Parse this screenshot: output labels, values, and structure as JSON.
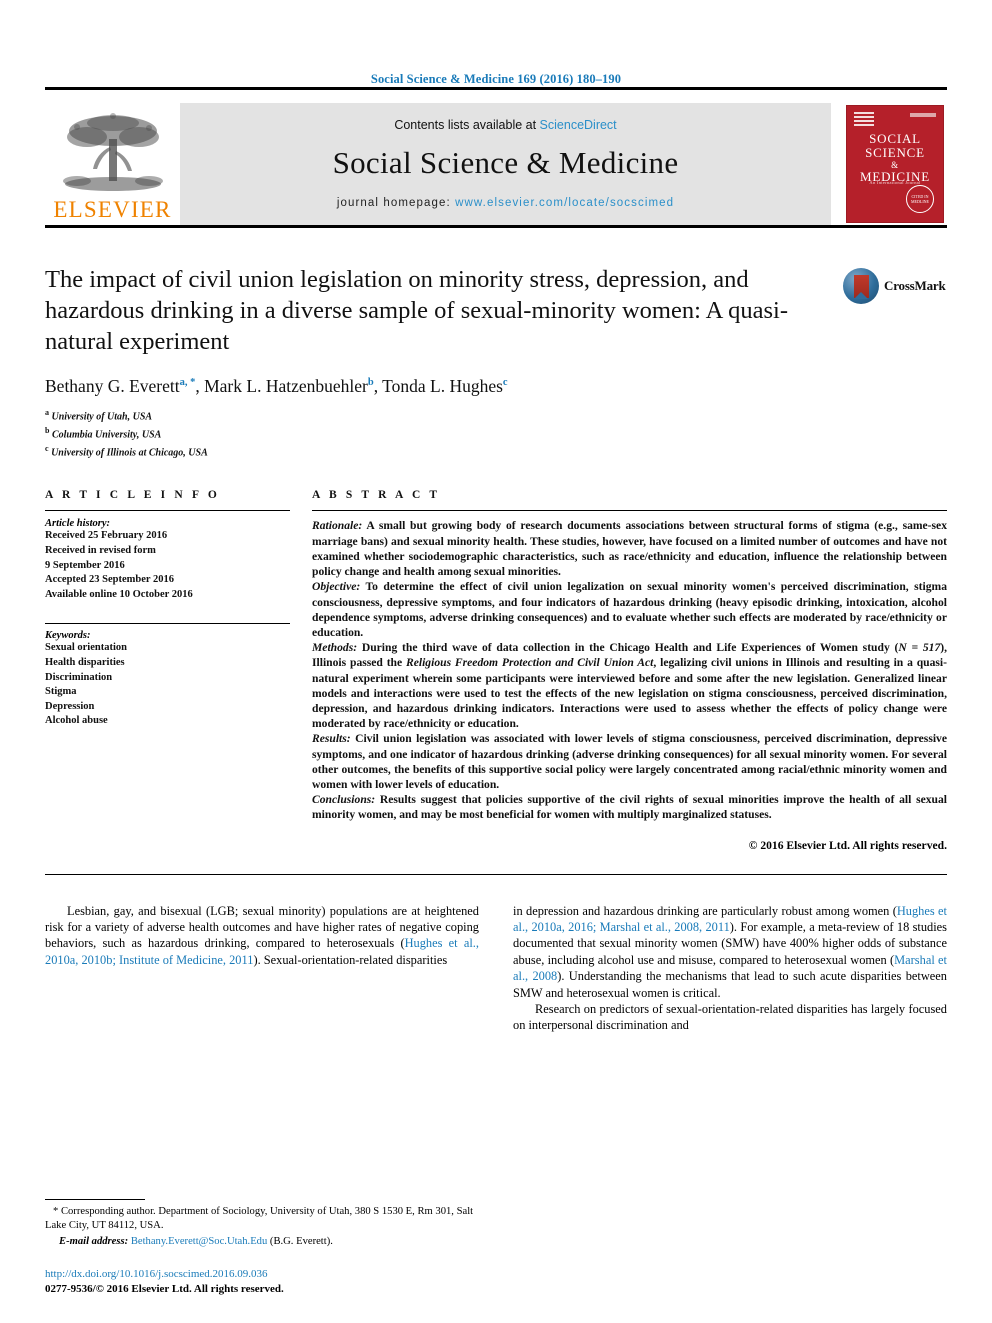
{
  "running_head": "Social Science & Medicine 169 (2016) 180–190",
  "masthead": {
    "publisher_wordmark": "ELSEVIER",
    "contents_prefix": "Contents lists available at ",
    "contents_link": "ScienceDirect",
    "journal_name": "Social Science & Medicine",
    "homepage_prefix": "journal homepage: ",
    "homepage_url": "www.elsevier.com/locate/socscimed",
    "cover": {
      "line1": "SOCIAL",
      "line2": "SCIENCE",
      "amp": "&",
      "line3": "MEDICINE",
      "tagline": "An International Journal",
      "seal_text": "CITED IN MEDLINE"
    }
  },
  "crossmark": {
    "label": "CrossMark"
  },
  "title": "The impact of civil union legislation on minority stress, depression, and hazardous drinking in a diverse sample of sexual-minority women: A quasi-natural experiment",
  "authors": [
    {
      "name": "Bethany G. Everett",
      "marks": "a, *"
    },
    {
      "name": "Mark L. Hatzenbuehler",
      "marks": "b"
    },
    {
      "name": "Tonda L. Hughes",
      "marks": "c"
    }
  ],
  "affiliations": [
    {
      "mark": "a",
      "text": "University of Utah, USA"
    },
    {
      "mark": "b",
      "text": "Columbia University, USA"
    },
    {
      "mark": "c",
      "text": "University of Illinois at Chicago, USA"
    }
  ],
  "article_info": {
    "heading": "A R T I C L E  I N F O",
    "history_label": "Article history:",
    "history": [
      "Received 25 February 2016",
      "Received in revised form",
      "9 September 2016",
      "Accepted 23 September 2016",
      "Available online 10 October 2016"
    ],
    "keywords_label": "Keywords:",
    "keywords": [
      "Sexual orientation",
      "Health disparities",
      "Discrimination",
      "Stigma",
      "Depression",
      "Alcohol abuse"
    ]
  },
  "abstract": {
    "heading": "A B S T R A C T",
    "rationale_label": "Rationale:",
    "rationale_text": " A small but growing body of research documents associations between structural forms of stigma (e.g., same-sex marriage bans) and sexual minority health. These studies, however, have focused on a limited number of outcomes and have not examined whether sociodemographic characteristics, such as race/ethnicity and education, influence the relationship between policy change and health among sexual minorities.",
    "objective_label": "Objective:",
    "objective_text": " To determine the effect of civil union legalization on sexual minority women's perceived discrimination, stigma consciousness, depressive symptoms, and four indicators of hazardous drinking (heavy episodic drinking, intoxication, alcohol dependence symptoms, adverse drinking consequences) and to evaluate whether such effects are moderated by race/ethnicity or education.",
    "methods_label": "Methods:",
    "methods_text_1": " During the third wave of data collection in the Chicago Health and Life Experiences of Women study (",
    "methods_n": "N = 517",
    "methods_text_2": "), Illinois passed the ",
    "methods_act": "Religious Freedom Protection and Civil Union Act",
    "methods_text_3": ", legalizing civil unions in Illinois and resulting in a quasi-natural experiment wherein some participants were interviewed before and some after the new legislation. Generalized linear models and interactions were used to test the effects of the new legislation on stigma consciousness, perceived discrimination, depression, and hazardous drinking indicators. Interactions were used to assess whether the effects of policy change were moderated by race/ethnicity or education.",
    "results_label": "Results:",
    "results_text": " Civil union legislation was associated with lower levels of stigma consciousness, perceived discrimination, depressive symptoms, and one indicator of hazardous drinking (adverse drinking consequences) for all sexual minority women. For several other outcomes, the benefits of this supportive social policy were largely concentrated among racial/ethnic minority women and women with lower levels of education.",
    "conclusions_label": "Conclusions:",
    "conclusions_text": " Results suggest that policies supportive of the civil rights of sexual minorities improve the health of all sexual minority women, and may be most beneficial for women with multiply marginalized statuses.",
    "copyright": "© 2016 Elsevier Ltd. All rights reserved."
  },
  "body": {
    "left_col": {
      "seg1": "Lesbian, gay, and bisexual (LGB; sexual minority) populations are at heightened risk for a variety of adverse health outcomes and have higher rates of negative coping behaviors, such as hazardous drinking, compared to heterosexuals (",
      "cite1": "Hughes et al., 2010a, 2010b; Institute of Medicine, 2011",
      "seg2": "). Sexual-orientation-related disparities"
    },
    "right_col": {
      "seg1": "in depression and hazardous drinking are particularly robust among women (",
      "cite1": "Hughes et al., 2010a, 2016; Marshal et al., 2008, 2011",
      "seg2": "). For example, a meta-review of 18 studies documented that sexual minority women (SMW) have 400% higher odds of substance abuse, including alcohol use and misuse, compared to heterosexual women (",
      "cite2": "Marshal et al., 2008",
      "seg3": "). Understanding the mechanisms that lead to such acute disparities between SMW and heterosexual women is critical.",
      "para2": "Research on predictors of sexual-orientation-related disparities has largely focused on interpersonal discrimination and"
    }
  },
  "footnotes": {
    "corresponding_marker": "*",
    "corresponding_text": " Corresponding author. Department of Sociology, University of Utah, 380 S 1530 E, Rm 301, Salt Lake City, UT 84112, USA.",
    "email_label": "E-mail address:",
    "email_value": "Bethany.Everett@Soc.Utah.Edu",
    "email_suffix": " (B.G. Everett).",
    "doi_url": "http://dx.doi.org/10.1016/j.socscimed.2016.09.036",
    "issn_line": "0277-9536/© 2016 Elsevier Ltd. All rights reserved."
  },
  "colors": {
    "link_blue": "#1a7bb9",
    "sciencedirect_blue": "#2a8fc9",
    "elsevier_orange": "#ef8200",
    "cover_red": "#b5202a"
  }
}
